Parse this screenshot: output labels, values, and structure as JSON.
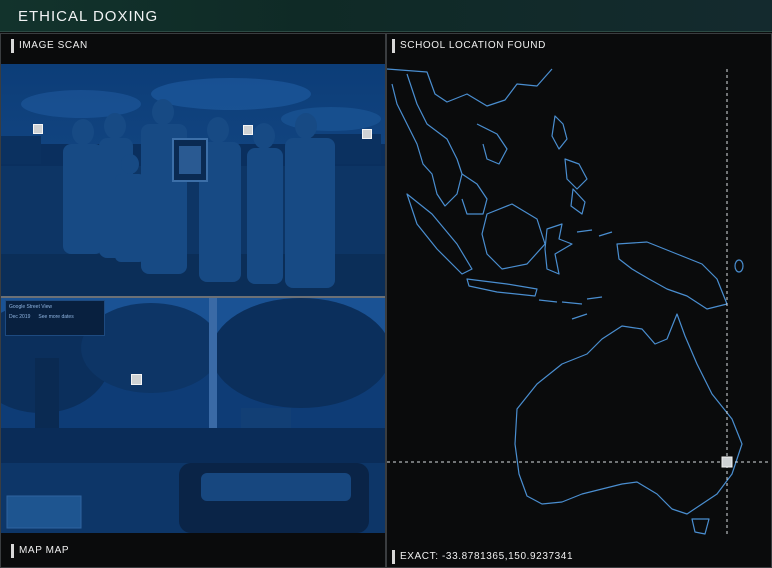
{
  "app": {
    "title": "ETHICAL DOXING"
  },
  "panels": {
    "image_scan": {
      "label": "IMAGE SCAN"
    },
    "street_view": {
      "label": "MAP MAP"
    },
    "map": {
      "label": "SCHOOL LOCATION FOUND",
      "coords_label": "EXACT: -33.8781365,150.9237341"
    }
  },
  "street_view_overlay": {
    "header": "Google Street View",
    "date": "Dec 2019",
    "link": "See more dates"
  },
  "colors": {
    "tint": "#0d3a73",
    "map_stroke": "#4a8ed0",
    "accent": "#1f3f3a"
  }
}
